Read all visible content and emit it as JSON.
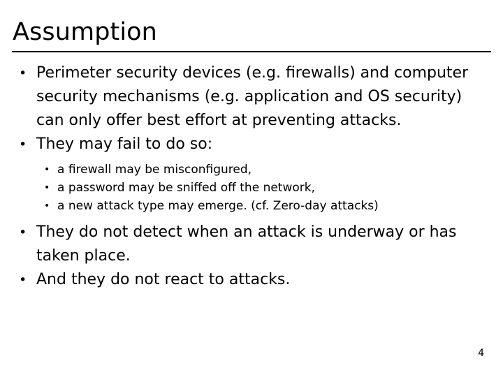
{
  "slide": {
    "title": "Assumption",
    "page_number": "4",
    "background_color": "#ffffff",
    "text_color": "#000000",
    "rule_color": "#000000",
    "bullet_glyph": "•"
  },
  "content": {
    "bullets": [
      {
        "level": 1,
        "text": "Perimeter security devices (e.g. firewalls) and computer security mechanisms (e.g. application and OS security) can only offer best effort at preventing attacks."
      },
      {
        "level": 1,
        "text": "They may fail to do so:"
      },
      {
        "level": 2,
        "text": "a firewall may be misconfigured,"
      },
      {
        "level": 2,
        "text": "a password may be sniffed off the network,"
      },
      {
        "level": 2,
        "text": "a new attack type may emerge. (cf. Zero-day attacks)"
      },
      {
        "level": 1,
        "text": "They do not detect when an attack is underway or has taken place."
      },
      {
        "level": 1,
        "text": "And they do not react to attacks."
      }
    ]
  }
}
